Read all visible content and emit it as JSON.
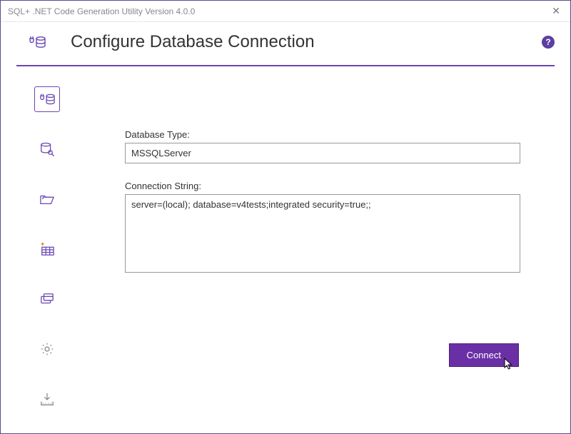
{
  "window": {
    "title": "SQL+ .NET Code Generation Utility Version 4.0.0"
  },
  "header": {
    "title": "Configure Database Connection",
    "help": "?"
  },
  "form": {
    "dbtype_label": "Database Type:",
    "dbtype_value": "MSSQLServer",
    "connstr_label": "Connection String:",
    "connstr_value": "server=(local); database=v4tests;integrated security=true;;",
    "connect_label": "Connect"
  }
}
